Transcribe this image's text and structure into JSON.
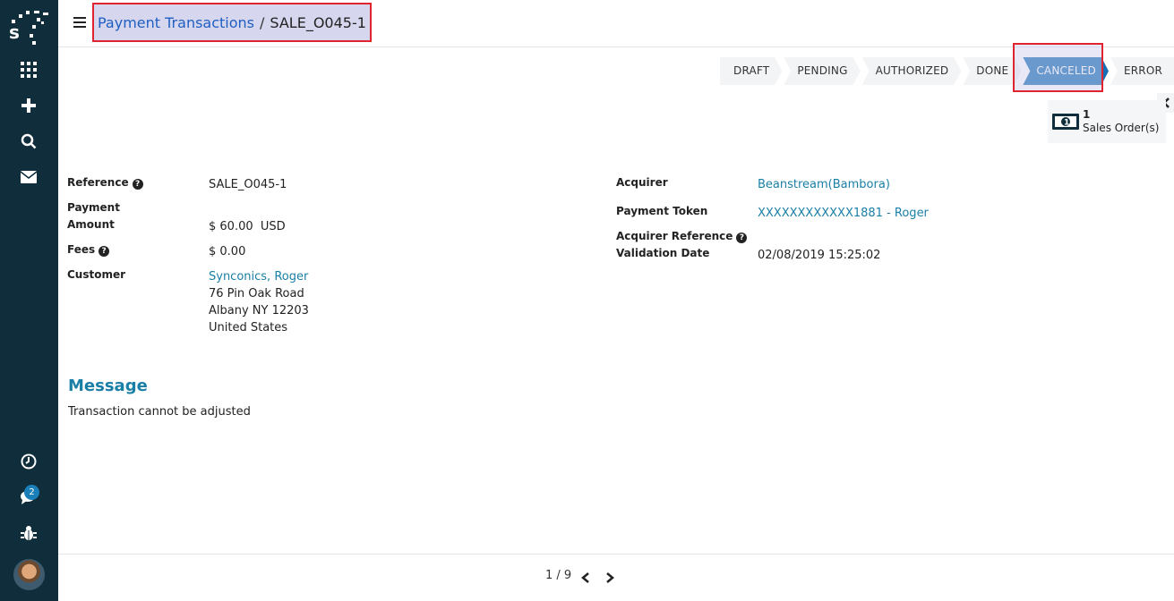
{
  "sidebar": {
    "logo": "s-logo-icon",
    "items": [
      {
        "name": "apps-grid-icon"
      },
      {
        "name": "plus-icon"
      },
      {
        "name": "search-icon"
      },
      {
        "name": "mail-icon"
      },
      {
        "name": "clock-icon"
      },
      {
        "name": "chat-icon",
        "badge": "2"
      },
      {
        "name": "bug-icon"
      },
      {
        "name": "avatar"
      }
    ]
  },
  "header": {
    "breadcrumb_parent": "Payment Transactions",
    "breadcrumb_separator": "/",
    "breadcrumb_current": "SALE_O045-1"
  },
  "status": {
    "stages": [
      "DRAFT",
      "PENDING",
      "AUTHORIZED",
      "DONE",
      "CANCELED",
      "ERROR"
    ],
    "active": "CANCELED"
  },
  "smart_button": {
    "count": "1",
    "label": "Sales Order(s)"
  },
  "form": {
    "left": {
      "reference_label": "Reference",
      "reference_value": "SALE_O045-1",
      "payment_label": "Payment",
      "amount_label": "Amount",
      "amount_value": "$ 60.00",
      "amount_currency": "USD",
      "fees_label": "Fees",
      "fees_value": "$ 0.00",
      "customer_label": "Customer",
      "customer_name": "Synconics, Roger",
      "customer_address_1": "76 Pin Oak Road",
      "customer_address_2": "Albany NY 12203",
      "customer_address_3": "United States"
    },
    "right": {
      "acquirer_label": "Acquirer",
      "acquirer_value": "Beanstream(Bambora)",
      "token_label": "Payment Token",
      "token_value": "XXXXXXXXXXXX1881 - Roger",
      "acq_ref_label": "Acquirer Reference",
      "validation_label": "Validation Date",
      "validation_value": "02/08/2019 15:25:02"
    }
  },
  "message": {
    "title": "Message",
    "text": "Transaction cannot be adjusted"
  },
  "pager": {
    "text": "1 / 9"
  },
  "colors": {
    "sidebar_bg": "#0f2d3a",
    "active_stage": "#1a6fb4",
    "link": "#1a7fa6",
    "highlight_border": "#e0242f"
  }
}
